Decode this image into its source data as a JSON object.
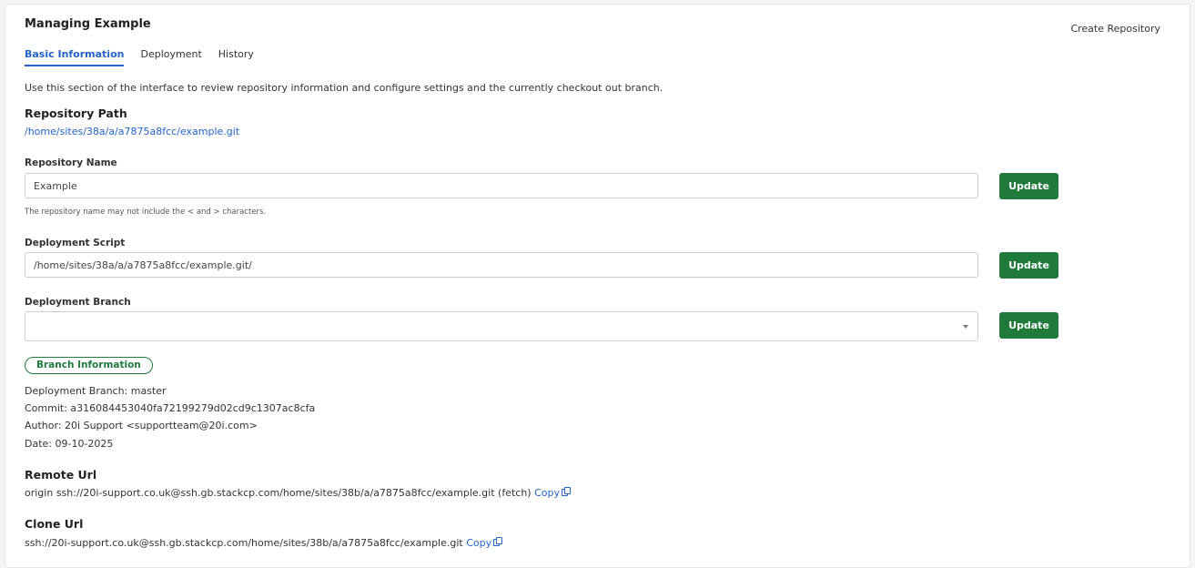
{
  "header": {
    "title": "Managing Example",
    "create_repository": "Create Repository"
  },
  "tabs": [
    {
      "label": "Basic Information",
      "active": true
    },
    {
      "label": "Deployment",
      "active": false
    },
    {
      "label": "History",
      "active": false
    }
  ],
  "intro": "Use this section of the interface to review repository information and configure settings and the currently checkout out branch.",
  "repository_path": {
    "heading": "Repository Path",
    "value": "/home/sites/38a/a/a7875a8fcc/example.git"
  },
  "repository_name": {
    "label": "Repository Name",
    "value": "Example",
    "hint": "The repository name may not include the < and > characters.",
    "button": "Update"
  },
  "deployment_script": {
    "label": "Deployment Script",
    "value": "/home/sites/38a/a/a7875a8fcc/example.git/",
    "button": "Update"
  },
  "deployment_branch": {
    "label": "Deployment Branch",
    "selected": "",
    "button": "Update"
  },
  "branch_information": {
    "badge": "Branch Information",
    "lines": [
      "Deployment Branch: master",
      "Commit: a316084453040fa72199279d02cd9c1307ac8cfa",
      "Author: 20i Support <supportteam@20i.com>",
      "Date: 09-10-2025"
    ]
  },
  "remote_url": {
    "heading": "Remote Url",
    "value": "origin ssh://20i-support.co.uk@ssh.gb.stackcp.com/home/sites/38b/a/a7875a8fcc/example.git (fetch)",
    "copy_label": "Copy"
  },
  "clone_url": {
    "heading": "Clone Url",
    "value": "ssh://20i-support.co.uk@ssh.gb.stackcp.com/home/sites/38b/a/a7875a8fcc/example.git",
    "copy_label": "Copy"
  },
  "colors": {
    "primary_button": "#1f7a3c",
    "link": "#2563c9"
  }
}
